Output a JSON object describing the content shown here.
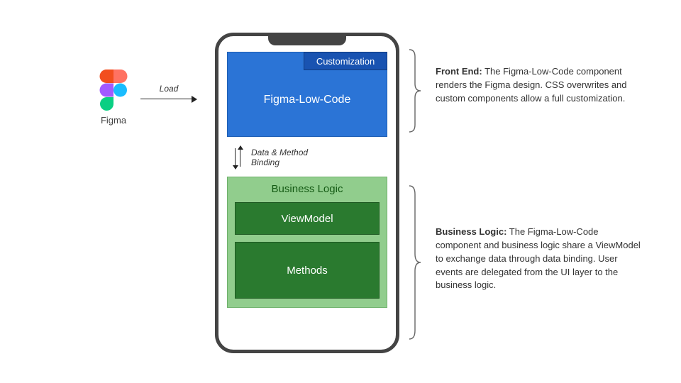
{
  "figma": {
    "label": "Figma"
  },
  "load_arrow": {
    "label": "Load"
  },
  "frontend": {
    "customization_label": "Customization",
    "main_label": "Figma-Low-Code"
  },
  "binding": {
    "line1": "Data & Method",
    "line2": "Binding"
  },
  "business_logic": {
    "title": "Business Logic",
    "viewmodel_label": "ViewModel",
    "methods_label": "Methods"
  },
  "descriptions": {
    "front_end": {
      "title": "Front End:",
      "body": " The Figma-Low-Code component renders the Figma design. CSS overwrites and custom components allow a full customization."
    },
    "bl": {
      "title": "Business Logic:",
      "body": " The Figma-Low-Code component and business logic share a ViewModel to exchange data through data binding. User events are delegated from the UI layer to the business logic."
    }
  }
}
